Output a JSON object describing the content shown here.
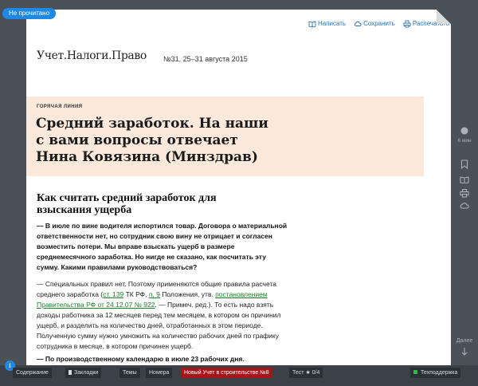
{
  "status": {
    "label": "Не прочитано"
  },
  "toolbar": {
    "write": "Написать",
    "save": "Сохранить",
    "print": "Распечатать"
  },
  "masthead": {
    "brand": "Учет.Налоги.Право",
    "issue": "№31, 25–31 августа 2015"
  },
  "article": {
    "rubric": "ГОРЯЧАЯ ЛИНИЯ",
    "headline": [
      "Средний заработок. На наши",
      "с вами вопросы отвечает",
      "Нина Ковязина (Минздрав)"
    ],
    "subhead": [
      "Как считать средний заработок для",
      "взыскания ущерба"
    ],
    "question": [
      "— В июле по вине водителя испортился товар. Договора о материальной",
      "ответственности нет, но сотрудник свою вину не отрицает и согласен",
      "возместить потери. Мы вправе взыскать ущерб в размере",
      "среднемесячного заработка. Но нигде не сказано, как посчитать эту",
      "сумму. Какими правилами руководствоваться?"
    ],
    "answer": {
      "line1": "— Специальных правил нет. Поэтому применяются общие правила расчета",
      "line2_a": "среднего заработка (",
      "link1": "ст. 139",
      "line2_b": " ТК РФ, ",
      "link2": "п. 9",
      "line2_c": " Положения, утв. ",
      "link3": "постановлением",
      "link4": "Правительства РФ от 24.12.07 № 922",
      "line3_b": ". — Примеч. ред.). То есть надо взять",
      "rest": [
        "доходы работника за 12 месяцев перед тем месяцем, в котором он причинил",
        "ущерб, и разделить на количество дней, отработанных в этом периоде.",
        "Полученную сумму нужно умножить на количество рабочих дней по графику",
        "сотрудника в месяце, в котором причинен ущерб."
      ]
    },
    "question2": [
      "— По производственному календарю в июле 23 рабочих дня."
    ]
  },
  "rail": {
    "time": "6 мин",
    "later": "Далее"
  },
  "bottom": {
    "info": "i",
    "contents": "Содержание",
    "bookmarks": "Закладки",
    "topics": "Темы",
    "issues": "Номера",
    "promo": "Новый Учет в строительстве №8",
    "test": "Тест",
    "test_score": "★ 0/4",
    "support": "Техподдержка"
  }
}
